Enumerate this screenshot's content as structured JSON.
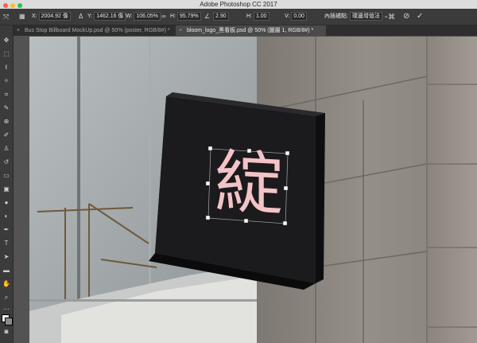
{
  "window": {
    "title": "Adobe Photoshop CC 2017"
  },
  "options": {
    "x_label": "X:",
    "x_value": "2004.92 像",
    "y_label": "Y:",
    "y_value": "1462.16 像",
    "w_label": "W:",
    "w_value": "106.05%",
    "h_label": "H:",
    "h_value": "95.79%",
    "angle_value": "2.90",
    "hskew_label": "H:",
    "hskew_value": "1.00",
    "vskew_label": "V:",
    "vskew_value": "0.00",
    "interp_label": "內插補點:",
    "interp_value": "環邊增值法"
  },
  "tabs": [
    {
      "label": "Bus Stop Billboard MockUp.psd @ 50% (poster, RGB/8#) *"
    },
    {
      "label": "bloom_logo_黑看板.psd @ 50% (圖層 1, RGB/8#) *"
    }
  ],
  "sign": {
    "glyph": "綻"
  },
  "colors": {
    "sign_face": "#1c1b1d",
    "glyph": "#f2c3c7",
    "wall": "#8c8781",
    "ui_dark": "#3b3b3b"
  },
  "icons": [
    "move-icon",
    "marquee-icon",
    "lasso-icon",
    "magic-wand-icon",
    "crop-icon",
    "eyedropper-icon",
    "healing-brush-icon",
    "brush-icon",
    "stamp-icon",
    "history-brush-icon",
    "eraser-icon",
    "gradient-icon",
    "blur-icon",
    "dodge-icon",
    "pen-icon",
    "type-icon",
    "path-select-icon",
    "rectangle-icon",
    "hand-icon",
    "zoom-icon"
  ]
}
